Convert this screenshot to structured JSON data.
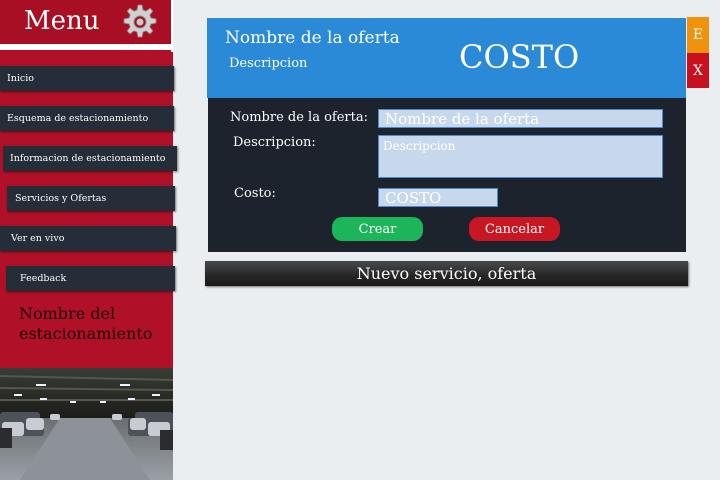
{
  "sidebar": {
    "title": "Menu",
    "items": [
      {
        "label": "Inicio"
      },
      {
        "label": "Esquema de estacionamiento"
      },
      {
        "label": "Informacion de estacionamiento"
      },
      {
        "label": "Servicios y Ofertas"
      },
      {
        "label": "Ver en vivo"
      },
      {
        "label": "Feedback"
      }
    ],
    "lot_name": "Nombre del estacionamiento"
  },
  "offer": {
    "name": "Nombre de la oferta",
    "description": "Descripcion",
    "cost": "COSTO",
    "edit_label": "E",
    "close_label": "X"
  },
  "form": {
    "name_label": "Nombre de la oferta:",
    "name_placeholder": "Nombre de la oferta",
    "desc_label": "Descripcion:",
    "desc_placeholder": "Descripcion",
    "cost_label": "Costo:",
    "cost_placeholder": "COSTO",
    "create_label": "Crear",
    "cancel_label": "Cancelar"
  },
  "footer": {
    "title": "Nuevo servicio, oferta"
  },
  "colors": {
    "sidebar": "#b01028",
    "nav": "#252d38",
    "offer_card": "#2a8ad8",
    "form_panel": "#1c232d",
    "edit": "#f0920c",
    "close": "#c8101e",
    "create": "#1cb559",
    "cancel": "#c81622"
  }
}
